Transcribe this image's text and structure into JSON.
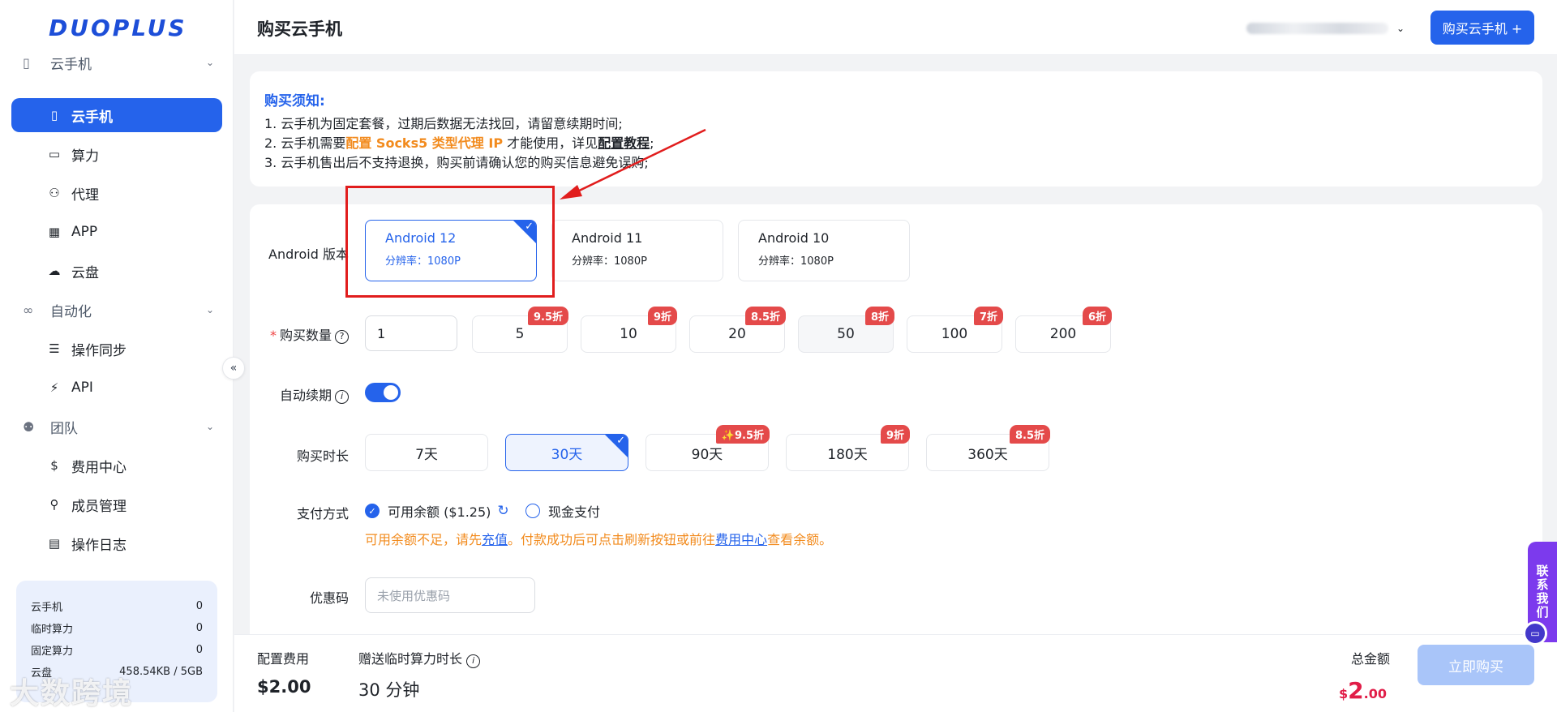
{
  "app": {
    "logo": "DUOPLUS",
    "page_title": "购买云手机"
  },
  "header": {
    "account_masked": "",
    "buy_button": "购买云手机 +"
  },
  "sidebar": {
    "groups": [
      {
        "label": "云手机",
        "icon": "phone-group-icon"
      },
      {
        "label": "自动化",
        "icon": "infinity-icon"
      },
      {
        "label": "团队",
        "icon": "team-icon"
      }
    ],
    "items": [
      {
        "label": "云手机",
        "icon": "mobile-icon",
        "active": true
      },
      {
        "label": "算力",
        "icon": "monitor-icon"
      },
      {
        "label": "代理",
        "icon": "network-icon"
      },
      {
        "label": "APP",
        "icon": "grid-icon"
      },
      {
        "label": "云盘",
        "icon": "cloud-icon"
      },
      {
        "label": "操作同步",
        "icon": "layers-icon"
      },
      {
        "label": "API",
        "icon": "plug-icon"
      },
      {
        "label": "费用中心",
        "icon": "dollar-icon"
      },
      {
        "label": "成员管理",
        "icon": "user-manage-icon"
      },
      {
        "label": "操作日志",
        "icon": "log-icon"
      }
    ],
    "collapse_glyph": "«",
    "usage": [
      {
        "label": "云手机",
        "value": "0"
      },
      {
        "label": "临时算力",
        "value": "0"
      },
      {
        "label": "固定算力",
        "value": "0"
      },
      {
        "label": "云盘",
        "value": "458.54KB / 5GB"
      }
    ]
  },
  "notice": {
    "title": "购买须知:",
    "line1": "1. 云手机为固定套餐，过期后数据无法找回，请留意续期时间;",
    "line2_a": "2. 云手机需要",
    "line2_b": "配置 Socks5 类型代理 IP",
    "line2_c": " 才能使用，详见",
    "line2_d": "配置教程",
    "line2_e": ";",
    "line3": "3. 云手机售出后不支持退换，购买前请确认您的购买信息避免误购;"
  },
  "form": {
    "android_label": "Android 版本",
    "versions": [
      {
        "name": "Android 12",
        "res": "分辨率：1080P",
        "selected": true
      },
      {
        "name": "Android 11",
        "res": "分辨率：1080P",
        "selected": false
      },
      {
        "name": "Android 10",
        "res": "分辨率：1080P",
        "selected": false
      }
    ],
    "qty_label": "购买数量",
    "qty_value": "1",
    "qty_options": [
      {
        "value": "5",
        "badge": "9.5折"
      },
      {
        "value": "10",
        "badge": "9折"
      },
      {
        "value": "20",
        "badge": "8.5折"
      },
      {
        "value": "50",
        "badge": "8折"
      },
      {
        "value": "100",
        "badge": "7折"
      },
      {
        "value": "200",
        "badge": "6折"
      }
    ],
    "auto_renew_label": "自动续期",
    "auto_renew_on": true,
    "duration_label": "购买时长",
    "durations": [
      {
        "value": "7天",
        "badge": ""
      },
      {
        "value": "30天",
        "badge": "",
        "selected": true
      },
      {
        "value": "90天",
        "badge": "✨9.5折"
      },
      {
        "value": "180天",
        "badge": "9折"
      },
      {
        "value": "360天",
        "badge": "8.5折"
      }
    ],
    "pay_label": "支付方式",
    "pay_balance": "可用余额 ($1.25)",
    "pay_cash": "现金支付",
    "warn_a": "可用余额不足，请先",
    "warn_link1": "充值",
    "warn_b": "。付款成功后可点击刷新按钮或前往",
    "warn_link2": "费用中心",
    "warn_c": "查看余额。",
    "coupon_label": "优惠码",
    "coupon_placeholder": "未使用优惠码"
  },
  "footer": {
    "config_label": "配置费用",
    "config_value": "$2.00",
    "gift_label": "赠送临时算力时长",
    "gift_value": "30 分钟",
    "total_label": "总金额",
    "total_currency": "$",
    "total_int": "2",
    "total_dec": ".00",
    "buy_now": "立即购买"
  },
  "contact": {
    "label": "联系我们"
  },
  "watermark": "大数跨境",
  "colors": {
    "primary": "#2563eb",
    "badge": "#e44a4a",
    "warn": "#f28b1e",
    "total": "#e11d48"
  }
}
